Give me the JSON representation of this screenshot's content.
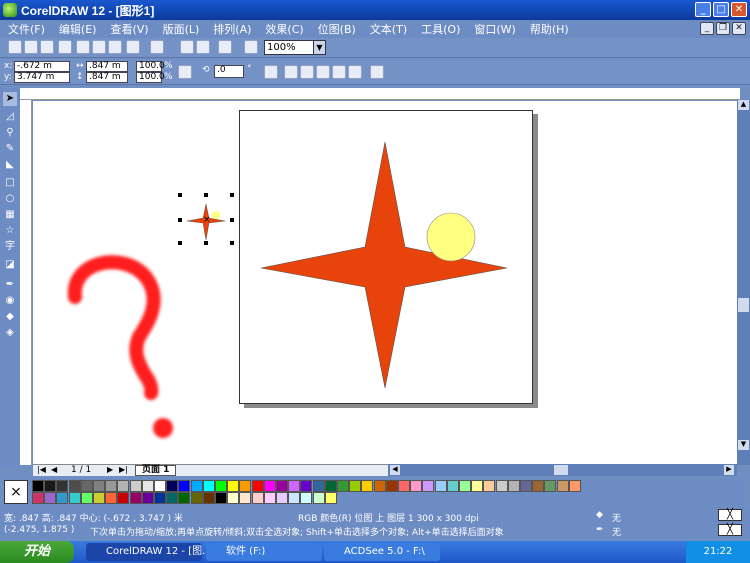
{
  "window": {
    "title": "CorelDRAW 12 - [图形1]"
  },
  "menu": [
    "文件(F)",
    "编辑(E)",
    "查看(V)",
    "版面(L)",
    "排列(A)",
    "效果(C)",
    "位图(B)",
    "文本(T)",
    "工具(O)",
    "窗口(W)",
    "帮助(H)"
  ],
  "toolbar": {
    "zoom": "100%"
  },
  "propbar": {
    "x": "-.672 m",
    "y": "3.747 m",
    "w": ".847 m",
    "h": ".847 m",
    "sx": "100.0",
    "sy": "100.0",
    "angle": ".0",
    "pct": "%",
    "deg": "°"
  },
  "pages": {
    "counter": "1 / 1",
    "tab": "页面 1"
  },
  "palette": {
    "colors": [
      "#000000",
      "#1a1a1a",
      "#333333",
      "#4d4d4d",
      "#666666",
      "#808080",
      "#999999",
      "#b3b3b3",
      "#cccccc",
      "#e6e6e6",
      "#ffffff",
      "#00005a",
      "#0000ff",
      "#00aaff",
      "#00ffff",
      "#00ff00",
      "#ffff00",
      "#ff9900",
      "#ff0000",
      "#ff00ff",
      "#990099",
      "#cc66ff",
      "#6600cc",
      "#336699",
      "#006633",
      "#339933",
      "#99cc00",
      "#ffcc00",
      "#cc6600",
      "#993300",
      "#ff6666",
      "#ff99cc",
      "#cc99ff",
      "#99ccff",
      "#66cccc",
      "#99ff99",
      "#ffff99",
      "#ffcc99",
      "#cccccc",
      "#b3b3b3",
      "#666699",
      "#996633",
      "#669966",
      "#cc9966",
      "#ff9966",
      "#cc3366",
      "#9966cc",
      "#3399cc",
      "#33cccc",
      "#66ff66",
      "#cccc33",
      "#ff6633",
      "#cc0000",
      "#990066",
      "#660099",
      "#003399",
      "#006666",
      "#006600",
      "#666600",
      "#663300",
      "#000000",
      "#ffffcc",
      "#ffe6cc",
      "#ffcccc",
      "#ffccff",
      "#e6ccff",
      "#cce6ff",
      "#ccffff",
      "#ccffcc",
      "#ffff66"
    ]
  },
  "status": {
    "size": "宽: .847   高: .847   中心: (-.672 , 3.747 )  米",
    "info": "RGB 颜色(R) 位图 上 图层 1 300 x 300 dpi",
    "coords": "(-2.475, 1.875 )",
    "hint": "下次单击为拖动/缩放;再单点旋转/倾斜;双击全选对象; Shift+单击选择多个对象; Alt+单击选择后面对象",
    "fill": "无",
    "outline": "无"
  },
  "taskbar": {
    "start": "开始",
    "tasks": [
      "CorelDRAW 12 - [图...",
      "软件 (F:)",
      "ACDSee 5.0 - F:\\"
    ],
    "clock": "21:22"
  },
  "colors": {
    "star": "#e8430a",
    "circle": "#ffff80",
    "question": "#ff1e1e"
  }
}
